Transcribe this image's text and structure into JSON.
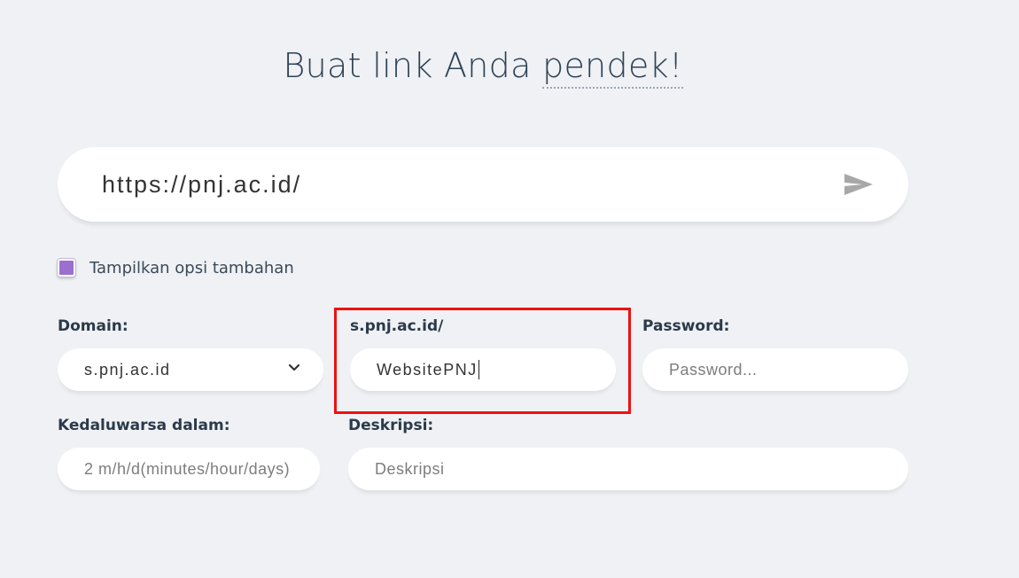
{
  "title": {
    "prefix": "Buat link Anda",
    "highlight": "pendek!"
  },
  "url_input": {
    "value": "https://pnj.ac.id/"
  },
  "send_button": {
    "icon": "send-icon"
  },
  "options_toggle": {
    "label": "Tampilkan opsi tambahan",
    "checked": true,
    "color": "#9b6ecf"
  },
  "domain": {
    "label": "Domain:",
    "selected": "s.pnj.ac.id"
  },
  "custom_url": {
    "label": "s.pnj.ac.id/",
    "value": "WebsitePNJ"
  },
  "password": {
    "label": "Password:",
    "placeholder": "Password..."
  },
  "expire": {
    "label": "Kedaluwarsa dalam:",
    "placeholder": "2 m/h/d(minutes/hour/days)"
  },
  "description": {
    "label": "Deskripsi:",
    "placeholder": "Deskripsi"
  },
  "colors": {
    "background": "#eff1f4",
    "highlight_box": "#ee1111"
  }
}
